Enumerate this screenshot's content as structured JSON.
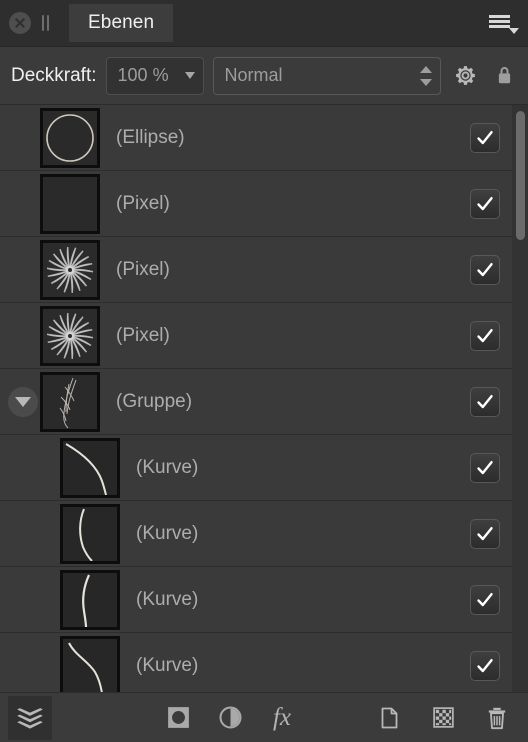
{
  "titlebar": {
    "close_icon": "close-circle-icon",
    "grip_icon": "pause-grip-icon",
    "tab_label": "Ebenen",
    "menu_icon": "hamburger-menu-icon"
  },
  "options": {
    "opacity_label": "Deckkraft:",
    "opacity_value": "100 %",
    "blend_mode_value": "Normal",
    "blend_mode_options": [
      "Normal"
    ],
    "gear_icon": "gear-icon",
    "lock_icon": "lock-icon"
  },
  "layers": [
    {
      "name": "(Ellipse)",
      "type": "ellipse",
      "indent": 0,
      "visible": true,
      "has_disclosure": false,
      "thumb": "circle-outline"
    },
    {
      "name": "(Pixel)",
      "type": "pixel",
      "indent": 0,
      "visible": true,
      "has_disclosure": false,
      "thumb": "empty-dark"
    },
    {
      "name": "(Pixel)",
      "type": "pixel",
      "indent": 0,
      "visible": true,
      "has_disclosure": false,
      "thumb": "spiral-flower"
    },
    {
      "name": "(Pixel)",
      "type": "pixel",
      "indent": 0,
      "visible": true,
      "has_disclosure": false,
      "thumb": "spiral-flower"
    },
    {
      "name": "(Gruppe)",
      "type": "group",
      "indent": 0,
      "visible": true,
      "has_disclosure": true,
      "expanded": true,
      "thumb": "curve-bundle"
    },
    {
      "name": "(Kurve)",
      "type": "curve",
      "indent": 1,
      "visible": true,
      "has_disclosure": false,
      "thumb": "curve-s-steep"
    },
    {
      "name": "(Kurve)",
      "type": "curve",
      "indent": 1,
      "visible": true,
      "has_disclosure": false,
      "thumb": "curve-vertical-bend"
    },
    {
      "name": "(Kurve)",
      "type": "curve",
      "indent": 1,
      "visible": true,
      "has_disclosure": false,
      "thumb": "curve-vertical-wave"
    },
    {
      "name": "(Kurve)",
      "type": "curve",
      "indent": 1,
      "visible": true,
      "has_disclosure": false,
      "thumb": "curve-s-shape"
    }
  ],
  "scrollbar": {
    "thumb_top_pct": 1,
    "thumb_height_pct": 22
  },
  "bottom_toolbar": {
    "layers_button": "layers-stack-icon",
    "mask_button": "mask-icon",
    "adjustment_button": "adjustment-icon",
    "fx_button": "fx",
    "new_layer_button": "new-layer-icon",
    "new_pixel_layer_button": "checkerboard-icon",
    "delete_button": "trash-icon"
  },
  "colors": {
    "panel_bg": "#333333",
    "titlebar_bg": "#2e2e2e",
    "row_bg": "#3a3a3a",
    "tab_bg": "#3d3d3d",
    "text": "#adadad",
    "text_bright": "#efefef"
  }
}
